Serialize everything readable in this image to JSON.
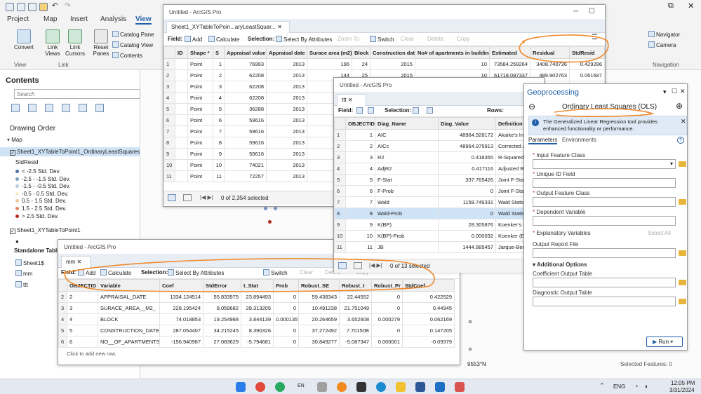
{
  "ribbon": {
    "tabs": [
      "Project",
      "Map",
      "Insert",
      "Analysis",
      "View"
    ],
    "active_tab": "View",
    "buttons": {
      "convert": "Convert",
      "link_views": "Link Views",
      "link_cursors": "Link Cursors",
      "reset_panes": "Reset Panes",
      "catalog_pane": "Catalog Pane",
      "catalog_view": "Catalog View",
      "contents": "Contents",
      "navigator": "Navigator",
      "camera": "Camera"
    },
    "groups": {
      "view": "View",
      "link": "Link",
      "navigation": "Navigation"
    }
  },
  "contents": {
    "title": "Contents",
    "search_placeholder": "Search",
    "drawing_order": "Drawing Order",
    "map": "Map",
    "layer1": "Sheet1_XYTableToPoint1_OrdinaryLeastSquares",
    "field": "StdResid",
    "classes": [
      {
        "label": "< -2.5 Std. Dev.",
        "color": "#4a6fa5"
      },
      {
        "label": "-2.5 - -1.5 Std. Dev.",
        "color": "#7a9cc6"
      },
      {
        "label": "-1.5 - -0.5 Std. Dev.",
        "color": "#b6c9e0"
      },
      {
        "label": "-0.5 - 0.5 Std. Dev.",
        "color": "#f2eecb"
      },
      {
        "label": "0.5 - 1.5 Std. Dev.",
        "color": "#f2c89a"
      },
      {
        "label": "1.5 - 2.5 Std. Dev.",
        "color": "#e0845f"
      },
      {
        "label": "> 2.5 Std. Dev.",
        "color": "#b22a20"
      }
    ],
    "layer2": "Sheet1_XYTableToPoint1",
    "standalone": "Standalone Tables",
    "tables": [
      "Sheet1$",
      "mm",
      "ttt"
    ]
  },
  "win1": {
    "title": "Untitled - ArcGIS Pro",
    "tab": "Sheet1_XYTableToPoin...aryLeastSquar...",
    "toolbar": {
      "field": "Field:",
      "add": "Add",
      "calculate": "Calculate",
      "selection": "Selection:",
      "select_by_attr": "Select By Attributes",
      "zoom_to": "Zoom To",
      "switch": "Switch",
      "clear": "Clear",
      "delete": "Delete",
      "copy": "Copy"
    },
    "columns": [
      "",
      "ID",
      "Shape *",
      "S",
      "Appraisal value",
      "Appraisal date",
      "Surace area (m2)",
      "Block",
      "Construction date",
      "No# of apartments in building",
      "Estimated",
      "Residual",
      "StdResid"
    ],
    "rows": [
      [
        "1",
        "",
        "Point",
        "1",
        "76993",
        "2013",
        "196",
        "24",
        "2015",
        "10",
        "73584.259264",
        "3408.740736",
        "0.429286"
      ],
      [
        "2",
        "",
        "Point",
        "2",
        "62208",
        "2013",
        "144",
        "25",
        "2015",
        "10",
        "61718.097337",
        "489.902763",
        "0.061687"
      ],
      [
        "3",
        "",
        "Point",
        "3",
        "62208",
        "2013",
        "",
        "",
        "",
        "",
        "",
        "",
        ""
      ],
      [
        "4",
        "",
        "Point",
        "4",
        "62208",
        "2013",
        "",
        "",
        "",
        "",
        "",
        "",
        ""
      ],
      [
        "5",
        "",
        "Point",
        "5",
        "36288",
        "2013",
        "",
        "",
        "",
        "",
        "",
        "",
        ""
      ],
      [
        "6",
        "",
        "Point",
        "6",
        "59616",
        "2013",
        "",
        "",
        "",
        "",
        "",
        "",
        ""
      ],
      [
        "7",
        "",
        "Point",
        "7",
        "59616",
        "2013",
        "",
        "",
        "",
        "",
        "",
        "",
        ""
      ],
      [
        "8",
        "",
        "Point",
        "8",
        "59616",
        "2013",
        "",
        "",
        "",
        "",
        "",
        "",
        ""
      ],
      [
        "9",
        "",
        "Point",
        "9",
        "59616",
        "2013",
        "",
        "",
        "",
        "",
        "",
        "",
        ""
      ],
      [
        "10",
        "",
        "Point",
        "10",
        "74021",
        "2013",
        "",
        "",
        "",
        "",
        "",
        "",
        ""
      ],
      [
        "11",
        "",
        "Point",
        "11",
        "72257",
        "2013",
        "",
        "",
        "",
        "",
        "",
        "",
        ""
      ]
    ],
    "status": "0 of 2,354 selected"
  },
  "win2": {
    "title": "Untitled - ArcGIS Pro",
    "tab": "ttt",
    "toolbar": {
      "field": "Field:",
      "selection": "Selection:",
      "rows": "Rows:"
    },
    "columns": [
      "",
      "OBJECTID *",
      "Diag_Name",
      "Diag_Value",
      "Definition"
    ],
    "rows": [
      [
        "1",
        "1",
        "AIC",
        "48964.928172",
        "Akaike's Informa"
      ],
      [
        "2",
        "2",
        "AICc",
        "48964.975913",
        "Corrected Akaik"
      ],
      [
        "3",
        "3",
        "R2",
        "0.418355",
        "R-Squared, Coef"
      ],
      [
        "4",
        "4",
        "AdjR2",
        "0.417116",
        "Adjusted R-Squ"
      ],
      [
        "5",
        "5",
        "F-Stat",
        "337.765426",
        "Joint F-Statistic"
      ],
      [
        "6",
        "6",
        "F-Prob",
        "0",
        "Joint F-Statistic"
      ],
      [
        "7",
        "7",
        "Wald",
        "1158.749331",
        "Wald Statistic: U"
      ],
      [
        "8",
        "8",
        "Wald-Prob",
        "0",
        "Wald Statistic Pr"
      ],
      [
        "9",
        "9",
        "K(BP)",
        "28.305876",
        "Koenker's stude"
      ],
      [
        "10",
        "10",
        "K(BP)-Prob",
        "0.000032",
        "Koenker (BP) St"
      ],
      [
        "11",
        "11",
        "JB",
        "1444.885457",
        "Jarque-Bera Sta"
      ]
    ],
    "status": "0 of 13 selected"
  },
  "win3": {
    "title": "Untitled - ArcGIS Pro",
    "tab": "mm",
    "toolbar": {
      "field": "Field:",
      "add": "Add",
      "calculate": "Calculate",
      "selection": "Selection:",
      "select_by_attr": "Select By Attributes",
      "switch": "Switch",
      "clear": "Clear",
      "delete": "Delete",
      "copy": "Copy"
    },
    "columns": [
      "",
      "OBJECTID *",
      "Variable",
      "Coef",
      "StdError",
      "t_Stat",
      "Prob",
      "Robust_SE",
      "Robust_t",
      "Robust_Pr",
      "StdCoef"
    ],
    "rows": [
      [
        "2",
        "2",
        "APPRAISAL_DATE",
        "1334.124514",
        "55.833975",
        "23.894493",
        "0",
        "59.438343",
        "22.44552",
        "0",
        "0.422529"
      ],
      [
        "3",
        "3",
        "SURACE_AREA__M2_",
        "228.195424",
        "8.059682",
        "28.313205",
        "0",
        "10.491238",
        "21.751049",
        "0",
        "0.44945"
      ],
      [
        "4",
        "4",
        "BLOCK",
        "74.018853",
        "19.254988",
        "3.844139",
        "0.000135",
        "20.264659",
        "3.652608",
        "0.000279",
        "0.062169"
      ],
      [
        "5",
        "5",
        "CONSTRUCTION_DATE",
        "287.054407",
        "34.215245",
        "8.390326",
        "0",
        "37.272492",
        "7.70150B",
        "0",
        "0.147205"
      ],
      [
        "6",
        "6",
        "NO__OF_APARTMENTS_...",
        "-156.940987",
        "27.083629",
        "-5.794681",
        "0",
        "30.849277",
        "-5.087347",
        "0.000001",
        "-0.09379"
      ]
    ],
    "add_row": "Click to add new row."
  },
  "geo": {
    "title": "Geoprocessing",
    "tool": "Ordinary Least Squares (OLS)",
    "info": "The Generalized Linear Regression tool provides enhanced functionality or performance.",
    "info_link": "Generalized Linear Regression",
    "tabs": [
      "Parameters",
      "Environments"
    ],
    "fields": [
      "Input Feature Class",
      "Unique ID Field",
      "Output Feature Class",
      "Dependent Variable",
      "Explanatory Variables",
      "Output Report File"
    ],
    "select_all": "Select All",
    "additional": "Additional Options",
    "extra_fields": [
      "Coefficient Output Table",
      "Diagnostic Output Table"
    ],
    "run": "Run"
  },
  "map": {
    "coord": "9553°N",
    "selected": "Selected Features: 0"
  },
  "taskbar": {
    "lang": "ENG",
    "time": "12:05 PM",
    "date": "3/31/2024",
    "en": "EN"
  },
  "annotation_color": "#ef8a2e"
}
